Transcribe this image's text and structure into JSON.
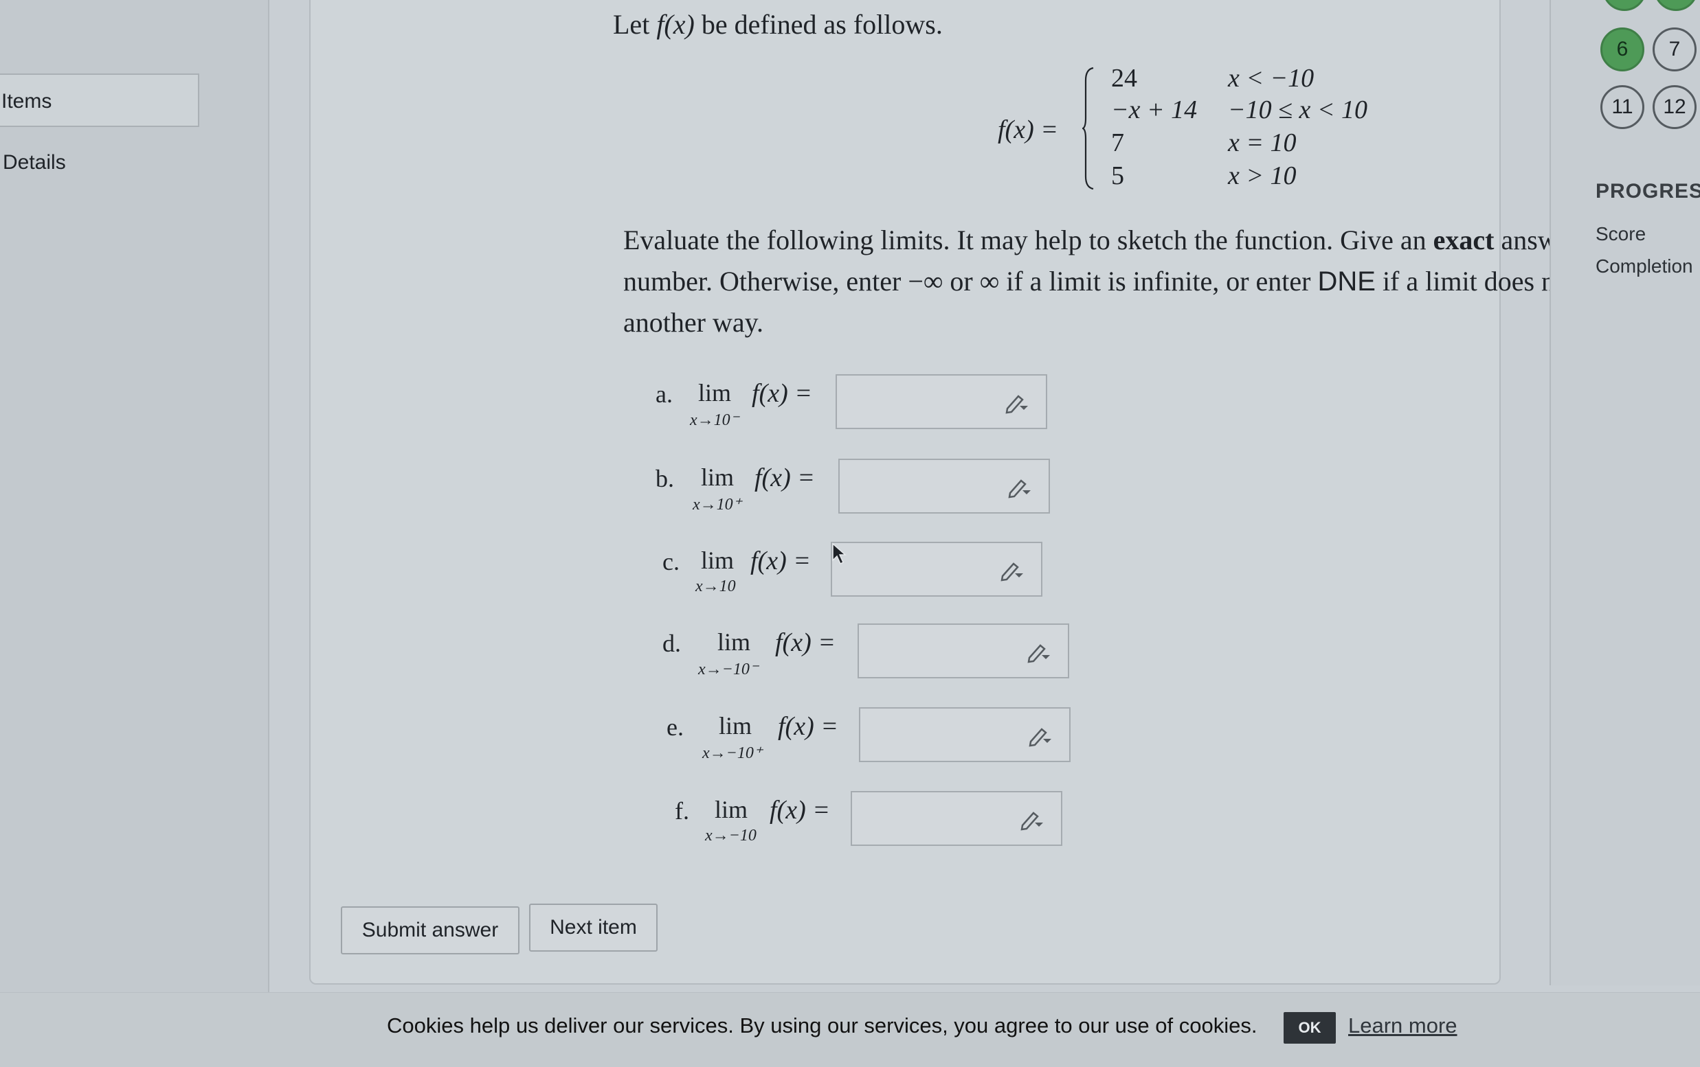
{
  "sidebar": {
    "items_label": "Items",
    "details_label": "Details"
  },
  "question": {
    "intro_prefix": "Let ",
    "intro_fx": "f(x)",
    "intro_suffix": " be defined as follows.",
    "piecewise": {
      "lhs": "f(x) =",
      "rows": [
        {
          "expr": "24",
          "cond": "x < −10"
        },
        {
          "expr": "−x + 14",
          "cond": "−10 ≤ x < 10"
        },
        {
          "expr": "7",
          "cond": "x = 10"
        },
        {
          "expr": "5",
          "cond": "x > 10"
        }
      ]
    },
    "instructions": {
      "p1": "Evaluate the following limits. It may help to sketch the function. Give an ",
      "exact": "exact",
      "p2": " answer if a limit is a number. Otherwise, enter ",
      "neg_inf": "−∞",
      "or": " or ",
      "inf": "∞",
      "p3": " if a limit is infinite, or enter ",
      "dne": "DNE",
      "p4": " if a limit does not exist in another way."
    },
    "limits": [
      {
        "letter": "a.",
        "lim": "lim",
        "sub": "x→10⁻",
        "expr": "f(x) =",
        "value": ""
      },
      {
        "letter": "b.",
        "lim": "lim",
        "sub": "x→10⁺",
        "expr": "f(x) =",
        "value": ""
      },
      {
        "letter": "c.",
        "lim": "lim",
        "sub": "x→10",
        "expr": "f(x) =",
        "value": ""
      },
      {
        "letter": "d.",
        "lim": "lim",
        "sub": "x→−10⁻",
        "expr": "f(x) =",
        "value": ""
      },
      {
        "letter": "e.",
        "lim": "lim",
        "sub": "x→−10⁺",
        "expr": "f(x) =",
        "value": ""
      },
      {
        "letter": "f.",
        "lim": "lim",
        "sub": "x→−10",
        "expr": "f(x) =",
        "value": ""
      }
    ],
    "submit_label": "Submit answer",
    "next_label": "Next item"
  },
  "navigator": {
    "items": [
      "6",
      "7",
      "11",
      "12"
    ],
    "progress_label": "PROGRESS",
    "score_label": "Score",
    "completion_label": "Completion"
  },
  "cookie_bar": {
    "text": "Cookies help us deliver our services. By using our services, you agree to our use of cookies.",
    "ok_label": "OK",
    "learn_more_label": "Learn more"
  },
  "colors": {
    "completed_green": "#4e9a57",
    "page_background": "#c9cfd4"
  }
}
